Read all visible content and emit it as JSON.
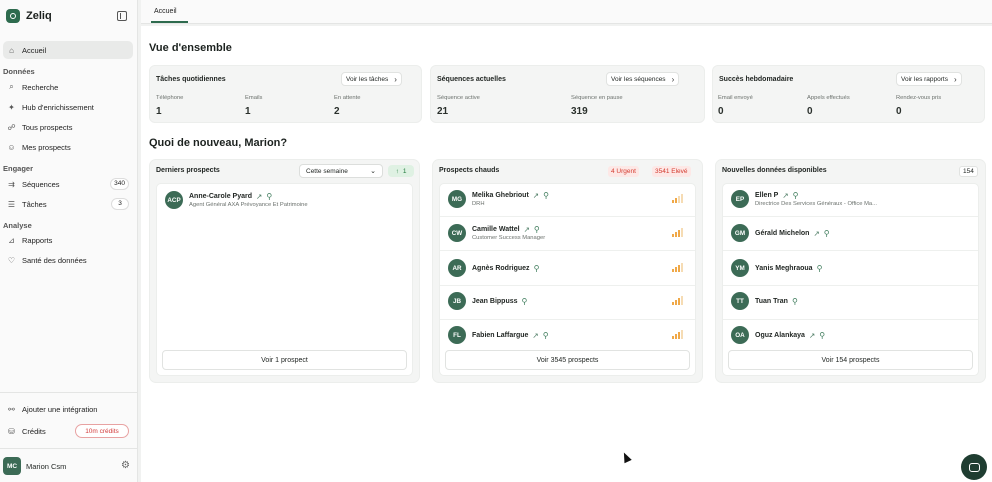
{
  "app": {
    "name": "Zeliq"
  },
  "topbar": {
    "tab": "Accueil"
  },
  "sidebar": {
    "home": "Accueil",
    "sections": {
      "donnees": "Données",
      "engager": "Engager",
      "analyse": "Analyse"
    },
    "items": [
      {
        "label": "Recherche",
        "icon": "search-icon"
      },
      {
        "label": "Hub d'enrichissement",
        "icon": "sparkle-icon"
      },
      {
        "label": "Tous prospects",
        "icon": "users-icon"
      },
      {
        "label": "Mes prospects",
        "icon": "user-icon"
      },
      {
        "label": "Séquences",
        "icon": "sequence-icon",
        "count": "340"
      },
      {
        "label": "Tâches",
        "icon": "task-icon",
        "count": "3"
      },
      {
        "label": "Rapports",
        "icon": "chart-icon"
      },
      {
        "label": "Santé des données",
        "icon": "heart-icon"
      }
    ],
    "integration": "Ajouter une intégration",
    "credits_label": "Crédits",
    "credits_badge": "10m crédits",
    "user": {
      "initials": "MC",
      "name": "Marion Csm"
    }
  },
  "overview": {
    "title": "Vue d'ensemble",
    "cards": [
      {
        "title": "Tâches quotidiennes",
        "button": "Voir les tâches",
        "stats": [
          {
            "label": "Téléphone",
            "value": "1"
          },
          {
            "label": "Emails",
            "value": "1"
          },
          {
            "label": "En attente",
            "value": "2"
          }
        ]
      },
      {
        "title": "Séquences actuelles",
        "button": "Voir les séquences",
        "stats": [
          {
            "label": "Séquence active",
            "value": "21"
          },
          {
            "label": "Séquence en pause",
            "value": "319"
          }
        ]
      },
      {
        "title": "Succès hebdomadaire",
        "button": "Voir les rapports",
        "stats": [
          {
            "label": "Email envoyé",
            "value": "0"
          },
          {
            "label": "Appels effectués",
            "value": "0"
          },
          {
            "label": "Rendez-vous pris",
            "value": "0"
          }
        ]
      }
    ]
  },
  "news": {
    "title": "Quoi de nouveau, Marion?",
    "latest": {
      "title": "Derniers prospects",
      "period": "Cette semaine",
      "trend": "1",
      "rows": [
        {
          "initials": "ACP",
          "name": "Anne-Carole Pyard",
          "sub": "Agent Général AXA Prévoyance Et Patrimoine"
        }
      ],
      "button": "Voir 1 prospect"
    },
    "hot": {
      "title": "Prospects chauds",
      "tag_urgent": "4 Urgent",
      "tag_high": "3541 Elevé",
      "rows": [
        {
          "initials": "MG",
          "name": "Melika Ghebriout",
          "sub": "DRH",
          "level": 0.5
        },
        {
          "initials": "CW",
          "name": "Camille Wattel",
          "sub": "Customer Success Manager",
          "level": 0.75
        },
        {
          "initials": "AR",
          "name": "Agnès Rodriguez",
          "sub": "",
          "level": 0.75
        },
        {
          "initials": "JB",
          "name": "Jean Bippuss",
          "sub": "",
          "level": 0.75
        },
        {
          "initials": "FL",
          "name": "Fabien Laffargue",
          "sub": "",
          "level": 0.75
        }
      ],
      "button": "Voir 3545 prospects"
    },
    "new_data": {
      "title": "Nouvelles données disponibles",
      "count": "154",
      "rows": [
        {
          "initials": "EP",
          "name": "Ellen P",
          "sub": "Directrice Des Services Généraux - Office Ma..."
        },
        {
          "initials": "GM",
          "name": "Gérald Michelon",
          "sub": ""
        },
        {
          "initials": "YM",
          "name": "Yanis Meghraoua",
          "sub": ""
        },
        {
          "initials": "TT",
          "name": "Tuan Tran",
          "sub": ""
        },
        {
          "initials": "OA",
          "name": "Oguz Alankaya",
          "sub": ""
        }
      ],
      "button": "Voir 154 prospects"
    }
  },
  "colors": {
    "brand": "#2e6b4e",
    "urgent": "#d43a2e",
    "signal": "#f0a847"
  }
}
